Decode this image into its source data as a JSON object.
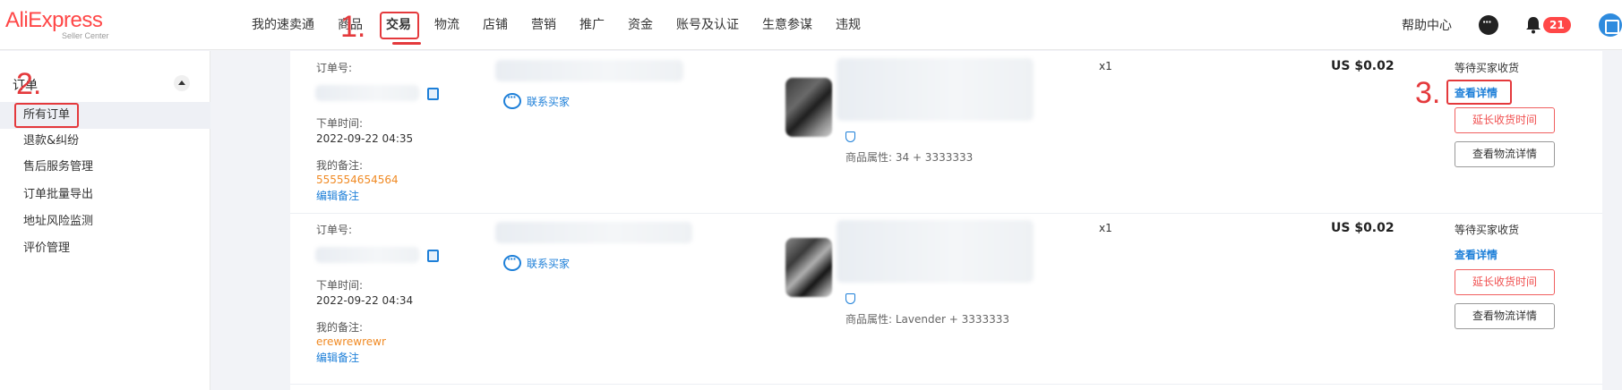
{
  "header": {
    "logo": "AliExpress",
    "logo_sub": "Seller Center",
    "nav": [
      "我的速卖通",
      "商品",
      "交易",
      "物流",
      "店铺",
      "营销",
      "推广",
      "资金",
      "账号及认证",
      "生意参谋",
      "违规"
    ],
    "active_nav": "交易",
    "help": "帮助中心",
    "notification_count": "21"
  },
  "annotations": {
    "step1": "1.",
    "step2": "2.",
    "step3": "3."
  },
  "sidebar": {
    "group": "订单",
    "items": [
      "所有订单",
      "退款&纠纷",
      "售后服务管理",
      "订单批量导出",
      "地址风险监测",
      "评价管理"
    ]
  },
  "labels": {
    "order_no": "订单号:",
    "order_time": "下单时间:",
    "my_note": "我的备注:",
    "edit_note": "编辑备注",
    "contact_buyer": "联系买家",
    "view_detail": "查看详情",
    "extend_receipt": "延长收货时间",
    "view_logistics": "查看物流详情"
  },
  "orders": [
    {
      "time": "2022-09-22 04:35",
      "note": "555554654564",
      "attr": "商品属性: 34 + 3333333",
      "qty": "x1",
      "price": "US $0.02",
      "status": "等待买家收货"
    },
    {
      "time": "2022-09-22 04:34",
      "note": "erewrewrewr",
      "attr": "商品属性: Lavender + 3333333",
      "qty": "x1",
      "price": "US $0.02",
      "status": "等待买家收货"
    }
  ],
  "colors": {
    "brand": "#ff4747",
    "annotation": "#e4393c",
    "link": "#1d7fd8",
    "note": "#f08a24"
  }
}
